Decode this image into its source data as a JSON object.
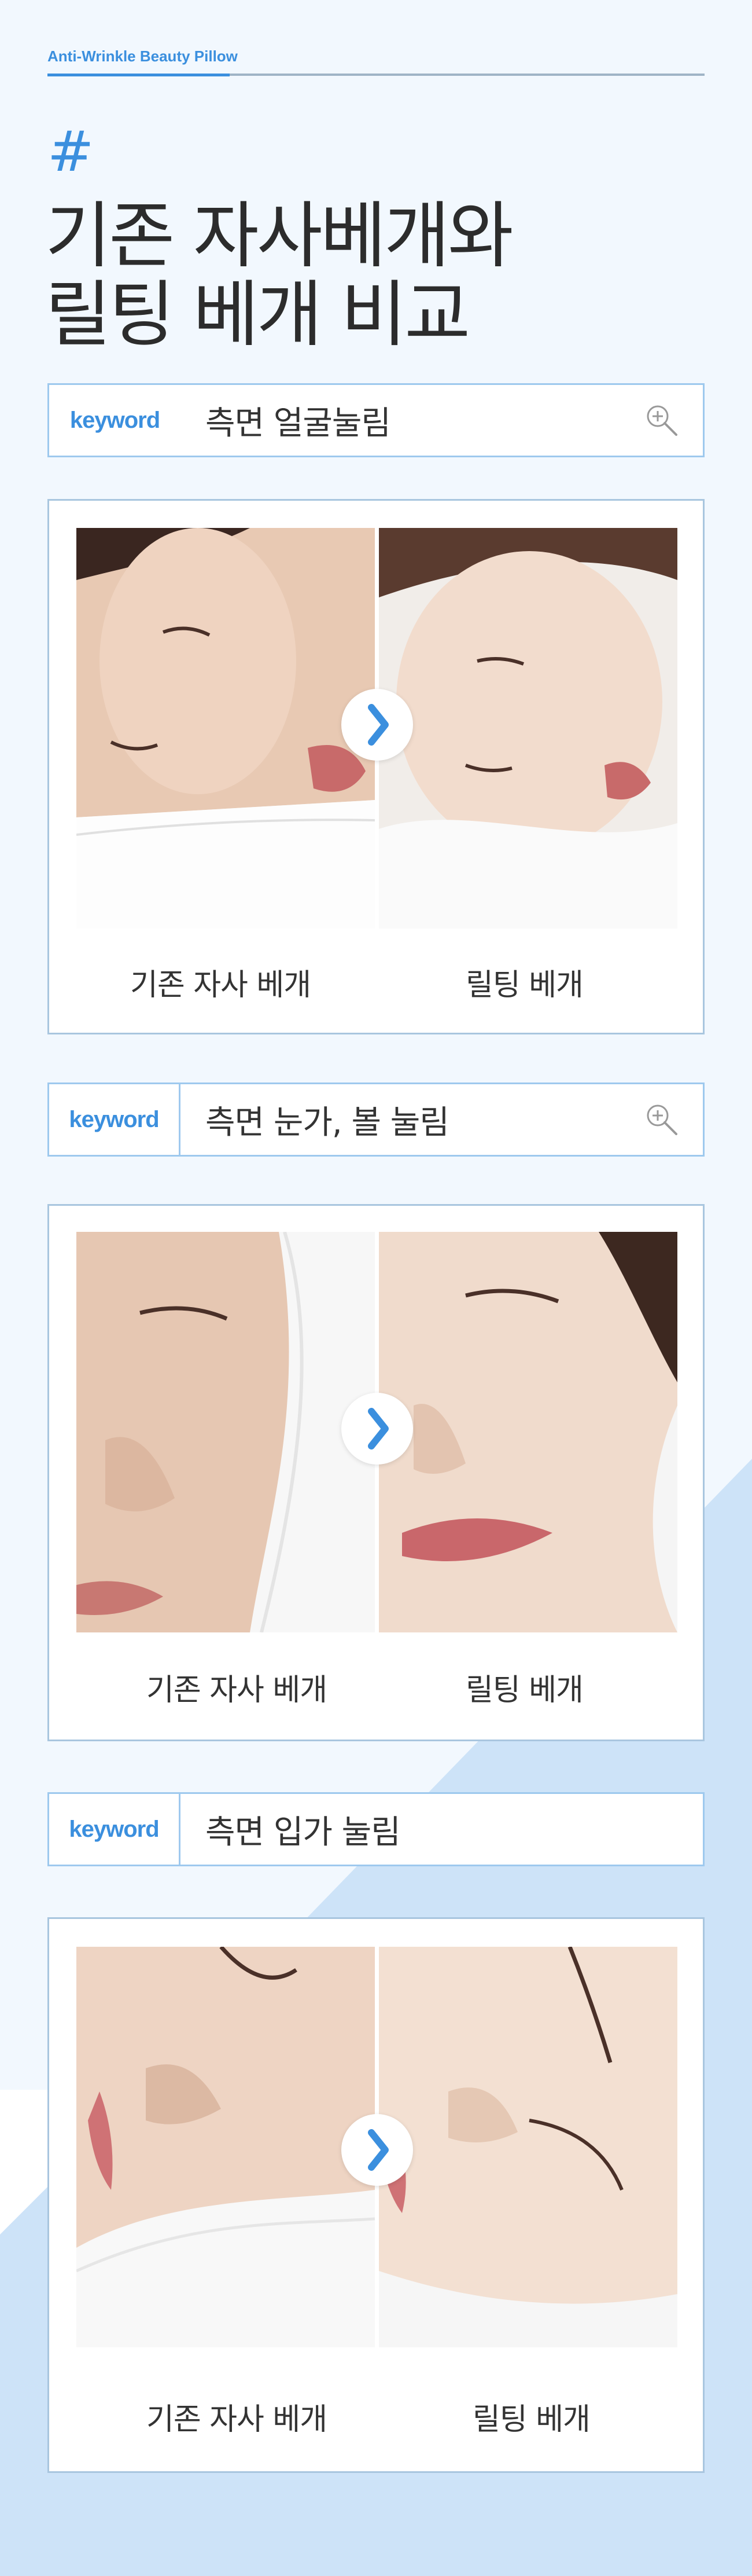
{
  "header": {
    "product_label": "Anti-Wrinkle Beauty Pillow",
    "hash": "#",
    "title_line1": "기존 자사베개와",
    "title_line2": "릴팅 베개 비교"
  },
  "sections": [
    {
      "keyword_tag": "keyword",
      "keyword_text": "측면 얼굴눌림",
      "left_caption": "기존 자사 베개",
      "right_caption": "릴팅 베개"
    },
    {
      "keyword_tag": "keyword",
      "keyword_text": "측면 눈가, 볼 눌림",
      "left_caption": "기존 자사 베개",
      "right_caption": "릴팅 베개"
    },
    {
      "keyword_tag": "keyword",
      "keyword_text": "측면 입가 눌림",
      "left_caption": "기존 자사 베개",
      "right_caption": "릴팅 베개"
    }
  ],
  "icons": {
    "zoom": "zoom-in-icon",
    "arrow": "chevron-right-icon"
  },
  "colors": {
    "accent": "#3b8fde",
    "background": "#f2f8fe",
    "bottom_background": "#cde3f8",
    "border": "#9ec9ee"
  }
}
